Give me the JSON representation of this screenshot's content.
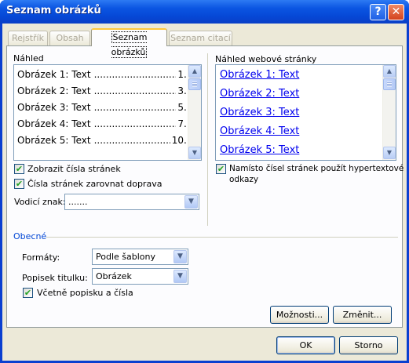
{
  "window": {
    "title": "Seznam obrázků"
  },
  "tabs": [
    {
      "label": "Rejstřík",
      "active": false
    },
    {
      "label": "Obsah",
      "active": false
    },
    {
      "label": "Seznam obrázků",
      "active": true
    },
    {
      "label": "Seznam citací",
      "active": false
    }
  ],
  "print_preview": {
    "label": "Náhled",
    "entries": [
      {
        "text": "Obrázek 1: Text",
        "leader": "....................................",
        "page": "1"
      },
      {
        "text": "Obrázek 2: Text",
        "leader": "....................................",
        "page": "3"
      },
      {
        "text": "Obrázek 3: Text",
        "leader": "....................................",
        "page": "5"
      },
      {
        "text": "Obrázek 4: Text",
        "leader": "....................................",
        "page": "7"
      },
      {
        "text": "Obrázek 5: Text",
        "leader": "....................................",
        "page": "10"
      }
    ]
  },
  "web_preview": {
    "label": "Náhled webové stránky",
    "entries": [
      "Obrázek 1: Text",
      "Obrázek 2: Text",
      "Obrázek 3: Text",
      "Obrázek 4: Text",
      "Obrázek 5: Text"
    ]
  },
  "options": {
    "show_page_numbers": {
      "label": "Zobrazit čísla stránek",
      "checked": true
    },
    "right_align": {
      "label": "Čísla stránek zarovnat doprava",
      "checked": true
    },
    "use_hyperlinks": {
      "label_line1": "Namísto čísel stránek použít hypertextové",
      "label_line2": "odkazy",
      "checked": true
    },
    "tab_leader": {
      "label": "Vodicí znak:",
      "value": "......."
    }
  },
  "general": {
    "label": "Obecné",
    "formats": {
      "label": "Formáty:",
      "value": "Podle šablony"
    },
    "caption_label": {
      "label": "Popisek titulku:",
      "value": "Obrázek"
    },
    "include_label": {
      "label": "Včetně popisku a čísla",
      "checked": true
    }
  },
  "buttons": {
    "options": "Možnosti...",
    "modify": "Změnit...",
    "ok": "OK",
    "cancel": "Storno"
  },
  "icons": {
    "help": "help-icon",
    "close": "close-icon",
    "check": "checkmark-icon",
    "dropdown": "chevron-down-icon",
    "scroll_up": "arrow-up-icon",
    "scroll_down": "arrow-down-icon"
  }
}
